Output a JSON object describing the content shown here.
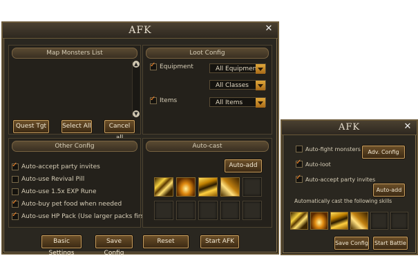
{
  "main": {
    "title": "AFK",
    "map_monsters": {
      "header": "Map Monsters List",
      "buttons": [
        "Quest Tgt",
        "Select All",
        "Cancel all"
      ]
    },
    "loot": {
      "header": "Loot Config",
      "equipment_label": "Equipment",
      "items_label": "Items",
      "equipment_value": "All Equipment",
      "classes_value": "All Classes",
      "items_value": "All Items"
    },
    "other": {
      "header": "Other Config",
      "options": [
        {
          "label": "Auto-accept party invites",
          "checked": true
        },
        {
          "label": "Auto-use Revival Pill",
          "checked": false
        },
        {
          "label": "Auto-use 1.5x EXP Rune",
          "checked": false
        },
        {
          "label": "Auto-buy pet food when needed",
          "checked": true
        },
        {
          "label": "Auto-use HP Pack (Use larger packs first)",
          "checked": true
        }
      ]
    },
    "autocast": {
      "header": "Auto-cast",
      "add_button": "Auto-add"
    },
    "footer": {
      "basic_settings": "Basic Settings",
      "save_config": "Save Config",
      "reset": "Reset",
      "start_afk": "Start AFK"
    }
  },
  "mini": {
    "title": "AFK",
    "auto_fight": "Auto-fight monsters",
    "auto_loot": "Auto-loot",
    "auto_accept": "Auto-accept party invites",
    "adv_config": "Adv. Config",
    "auto_add": "Auto-add",
    "cast_label": "Automatically cast the following skills",
    "save_config": "Save Config",
    "start_battle": "Start Battle"
  }
}
